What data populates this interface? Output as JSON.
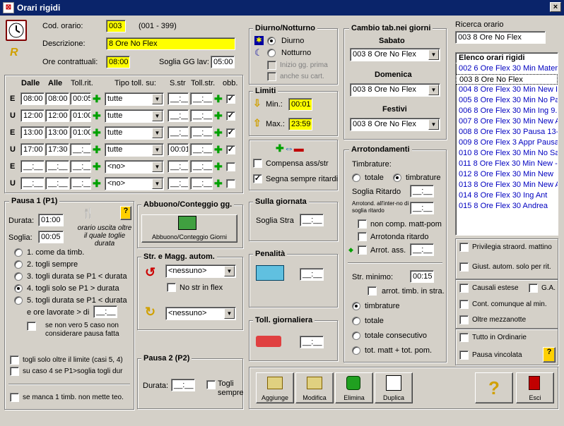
{
  "window": {
    "title": "Orari rigidi",
    "close": "×"
  },
  "header": {
    "cod_label": "Cod. orario:",
    "cod_value": "003",
    "cod_range": "(001 - 399)",
    "desc_label": "Descrizione:",
    "desc_value": "8 Ore No Flex",
    "ore_label": "Ore contrattuali:",
    "ore_value": "08:00",
    "soglia_label": "Soglia GG lav:",
    "soglia_value": "05:00"
  },
  "diurno": {
    "title": "Diurno/Notturno",
    "diurno": "Diurno",
    "notturno": "Notturno",
    "inizio": "Inizio gg. prima",
    "anche": "anche su cart."
  },
  "limiti": {
    "title": "Limiti",
    "min_label": "Min.:",
    "min_value": "00:01",
    "max_label": "Max.:",
    "max_value": "23:59"
  },
  "compensa": {
    "compensa": "Compensa ass/str",
    "segna": "Segna sempre ritardi"
  },
  "cambio": {
    "title": "Cambio tab.nei giorni",
    "sabato": "Sabato",
    "sabato_value": "003  8 Ore No Flex",
    "domenica": "Domenica",
    "domenica_value": "003  8 Ore No Flex",
    "festivi": "Festivi",
    "festivi_value": "003  8 Ore No Flex"
  },
  "ricerca": {
    "label": "Ricerca orario",
    "value": "003  8 Ore No Flex"
  },
  "elenco": {
    "title": "Elenco orari rigidi",
    "items": [
      "002  6 Ore Flex 30 Min Mater",
      "003  8 Ore No Flex",
      "004  8 Ore Flex 30 Min New I",
      "005  8 Ore Flex 30 Min No Pa",
      "006  8 Ore Flex 30 Min Ing 9.",
      "007  8 Ore Flex 30 Min New A",
      "008  8 Ore Flex 30 Pausa 13-",
      "009  8 Ore Flex 3 Appr Pausa",
      "010  8 Ore Flex 30 Min No Sa",
      "011  8 Ore Flex 30 Min New -",
      "012  8 Ore Flex 30 Min New",
      "013  8 Ore Flex 30 Min New A",
      "014  8 Ore Flex 30 Ing Ant",
      "015  8 Ore Flex 30 Andrea"
    ]
  },
  "table": {
    "h_dalle": "Dalle",
    "h_alle": "Alle",
    "h_tollrit": "Toll.rit.",
    "h_tipo": "Tipo toll. su:",
    "h_sstr": "S.str",
    "h_tollstr": "Toll.str.",
    "h_obb": "obb.",
    "rows": [
      {
        "eu": "E",
        "dalle": "08:00",
        "alle": "08:00",
        "toll": "00:05",
        "tipo": "tutte",
        "sstr": "__:__",
        "tstr": "__:__",
        "obb": "✓"
      },
      {
        "eu": "U",
        "dalle": "12:00",
        "alle": "12:00",
        "toll": "01:00",
        "tipo": "tutte",
        "sstr": "__:__",
        "tstr": "__:__",
        "obb": "✓"
      },
      {
        "eu": "E",
        "dalle": "13:00",
        "alle": "13:00",
        "toll": "01:00",
        "tipo": "tutte",
        "sstr": "__:__",
        "tstr": "__:__",
        "obb": "✓"
      },
      {
        "eu": "U",
        "dalle": "17:00",
        "alle": "17:30",
        "toll": "__:__",
        "tipo": "tutte",
        "sstr": "00:01",
        "tstr": "__:__",
        "obb": "✓"
      },
      {
        "eu": "E",
        "dalle": "__:__",
        "alle": "__:__",
        "toll": "__:__",
        "tipo": "<no>",
        "sstr": "__:__",
        "tstr": "__:__",
        "obb": ""
      },
      {
        "eu": "U",
        "dalle": "__:__",
        "alle": "__:__",
        "toll": "__:__",
        "tipo": "<no>",
        "sstr": "__:__",
        "tstr": "__:__",
        "obb": ""
      }
    ]
  },
  "pausa1": {
    "title": "Pausa 1 (P1)",
    "durata_label": "Durata:",
    "durata": "01:00",
    "soglia_label": "Soglia:",
    "soglia": "00:05",
    "note": "orario uscita oltre il quale toglie durata",
    "opt1": "1. come da timb.",
    "opt2": "2. togli sempre",
    "opt3": "3. togli durata se P1 < durata",
    "opt4": "4. togli solo se P1 > durata",
    "opt5": "5. togli durata se P1 < durata",
    "ore_lav": "e ore lavorate > di",
    "ore_lav_val": "__:__",
    "non_vero": "se non vero 5 caso non considerare pausa fatta",
    "togli_oltre": "togli solo oltre il limite (casi 5, 4)",
    "su_caso": "su caso 4 se P1>soglia togli dur",
    "se_manca": "se manca 1 timb. non mette teo.",
    "help": "?"
  },
  "abbuono": {
    "title": "Abbuono/Conteggio gg.",
    "btn": "Abbuono/Conteggio Giorni"
  },
  "str_magg": {
    "title": "Str. e Magg. autom.",
    "combo1": "<nessuno>",
    "no_str": "No str in flex",
    "combo2": "<nessuno>"
  },
  "pausa2": {
    "title": "Pausa 2 (P2)",
    "durata_label": "Durata:",
    "durata": "__:__",
    "togli": "Togli sempre"
  },
  "giornata": {
    "title": "Sulla giornata",
    "soglia_label": "Soglia Stra",
    "soglia": "__:__"
  },
  "penalita": {
    "title": "Penalità",
    "value": "__:__"
  },
  "toll_g": {
    "title": "Toll. giornaliera",
    "value": "__:__"
  },
  "arrot": {
    "title": "Arrotondamenti",
    "timbrature": "Timbrature:",
    "totale": "totale",
    "timbrature_opt": "timbrature",
    "soglia_rit": "Soglia Ritardo",
    "soglia_rit_val": "__:__",
    "arrot_int": "Arrotond. all'inter-no di soglia ritardo",
    "arrot_int_val": "__:__",
    "non_comp": "non comp. matt-pom",
    "arr_rit": "Arrotonda ritardo",
    "arr_ass": "Arrot. ass.",
    "arr_ass_val": "__:__",
    "str_min": "Str. minimo:",
    "str_min_val": "00:15",
    "arrot_timb": "arrot. timb. in stra.",
    "r_timb": "timbrature",
    "r_tot": "totale",
    "r_tot_cons": "totale consecutivo",
    "r_tot_mp": "tot. matt + tot. pom."
  },
  "right_opts": {
    "privilegia": "Privilegia straord. mattino",
    "giust": "Giust. autom. solo per rit.",
    "causali": "Causali estese",
    "ga": "G.A.",
    "cont": "Cont. comunque al min.",
    "oltre": "Oltre mezzanotte",
    "tutto": "Tutto in Ordinarie",
    "pausa_v": "Pausa vincolata",
    "help": "?"
  },
  "toolbar": {
    "aggiunge": "Aggiunge",
    "modifica": "Modifica",
    "elimina": "Elimina",
    "duplica": "Duplica",
    "esci": "Esci",
    "help": "?"
  }
}
